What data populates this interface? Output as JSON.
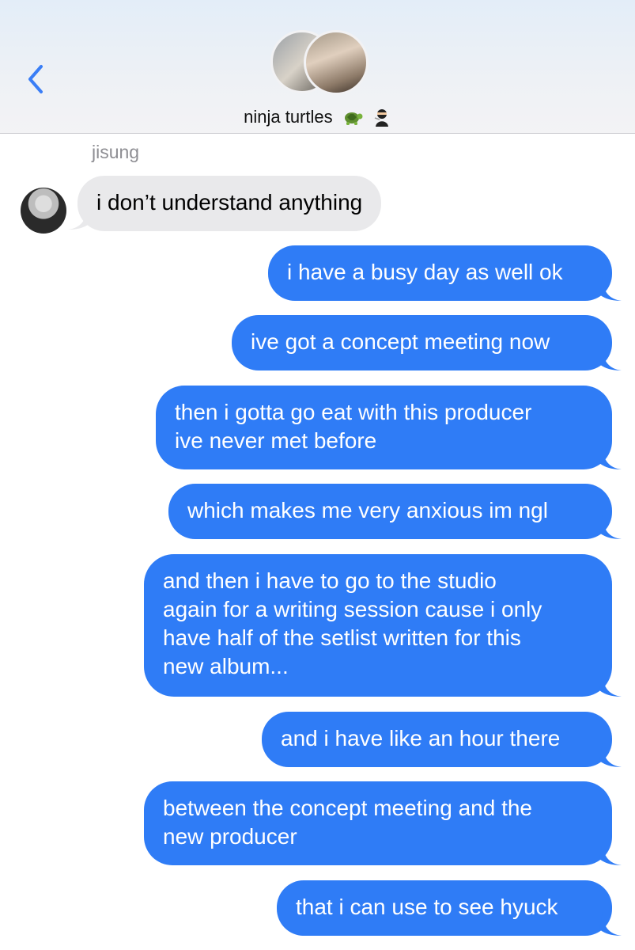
{
  "header": {
    "back_icon": "chevron-left-icon",
    "group_name": "ninja turtles",
    "group_emojis": [
      "turtle-icon",
      "ninja-icon"
    ],
    "accent": "#3a7ef6"
  },
  "conversation": {
    "sender_name": "jisung",
    "messages": [
      {
        "direction": "in",
        "lines": [
          "i don’t understand anything"
        ]
      },
      {
        "direction": "out",
        "lines": [
          "i have a busy day as well ok"
        ]
      },
      {
        "direction": "out",
        "lines": [
          "ive got a concept meeting now"
        ]
      },
      {
        "direction": "out",
        "lines": [
          "then i gotta go eat with this producer",
          "ive never met before"
        ]
      },
      {
        "direction": "out",
        "lines": [
          "which makes me very anxious im ngl"
        ]
      },
      {
        "direction": "out",
        "lines": [
          "and then i have to go to the studio",
          "again for a writing session cause i only",
          "have half of the setlist written for this",
          "new album..."
        ]
      },
      {
        "direction": "out",
        "lines": [
          "and i have like an hour there"
        ]
      },
      {
        "direction": "out",
        "lines": [
          "between the concept meeting and the",
          "new producer"
        ]
      },
      {
        "direction": "out",
        "lines": [
          "that i can use to see hyuck"
        ]
      }
    ]
  },
  "colors": {
    "outgoing_bubble": "#2f7cf6",
    "incoming_bubble": "#e9e9eb",
    "sender_label": "#8e8e93"
  }
}
